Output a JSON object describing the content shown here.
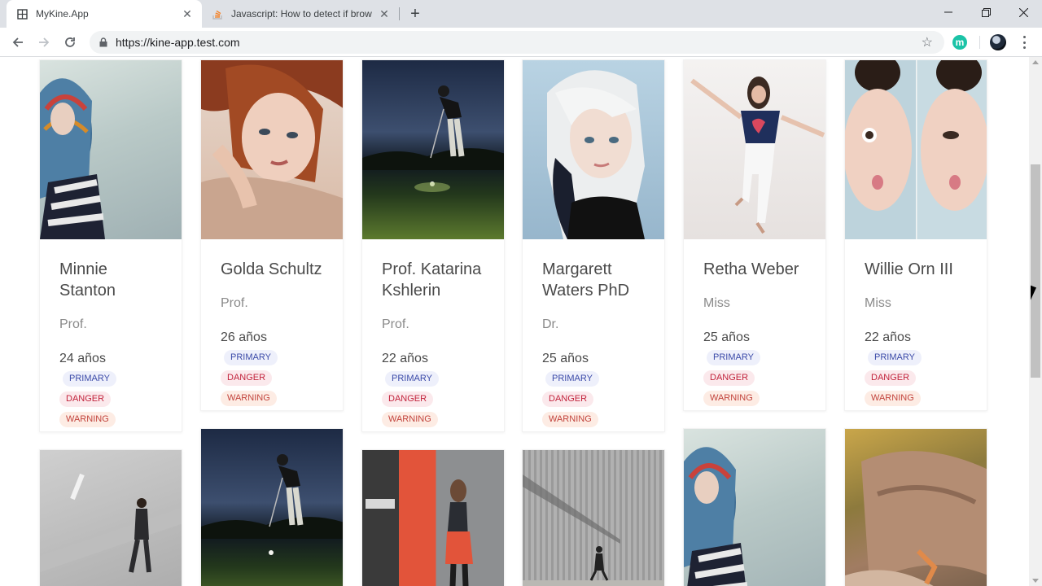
{
  "tabs": [
    {
      "title": "MyKine.App",
      "active": true
    },
    {
      "title": "Javascript: How to detect if brow",
      "active": false
    }
  ],
  "address_bar": {
    "url": "https://kine-app.test.com"
  },
  "extension": {
    "letter": "m",
    "color": "#1bc3a7"
  },
  "badge_labels": {
    "primary": "PRIMARY",
    "danger": "DANGER",
    "warning": "WARNING"
  },
  "colors": {
    "primary_badge": "#3b4aa8",
    "danger_badge": "#c2233c",
    "warning_badge": "#c2433c"
  },
  "cards": [
    {
      "name": "Minnie Stanton",
      "title": "Prof.",
      "age": "24 años"
    },
    {
      "name": "Golda Schultz",
      "title": "Prof.",
      "age": "26 años"
    },
    {
      "name": "Prof. Katarina Kshlerin",
      "title": "Prof.",
      "age": "22 años"
    },
    {
      "name": "Margarett Waters PhD",
      "title": "Dr.",
      "age": "25 años"
    },
    {
      "name": "Retha Weber",
      "title": "Miss",
      "age": "25 años"
    },
    {
      "name": "Willie Orn III",
      "title": "Miss",
      "age": "22 años"
    }
  ]
}
